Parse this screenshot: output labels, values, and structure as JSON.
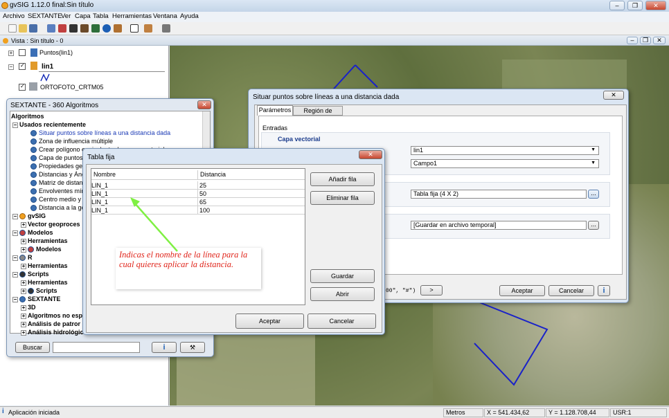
{
  "app": {
    "title": "gvSIG 1.12.0 final:Sin título",
    "minimize": "–",
    "restore": "❐",
    "close": "✕"
  },
  "menu": [
    "Archivo",
    "SEXTANTE",
    "Ver",
    "Capa",
    "Tabla",
    "Herramientas",
    "Ventana",
    "Ayuda"
  ],
  "view": {
    "title": "Vista : Sin título - 0"
  },
  "layers": [
    {
      "name": "Puntos(lin1)"
    },
    {
      "name": "lin1"
    },
    {
      "name": "ORTOFOTO_CRTM05"
    }
  ],
  "sextante": {
    "title": "SEXTANTE - 360 Algoritmos",
    "root": "Algoritmos",
    "recent": "Usados recientemente",
    "recent_items": [
      "Situar puntos sobre líneas a una distancia dada",
      "Zona de influencia múltiple",
      "Crear polígono equivalente de mapa vectorial",
      "Capa de puntos",
      "Propiedades geo",
      "Distancias y Áng",
      "Matriz de distanc",
      "Envolventes mín",
      "Centro medio y d",
      "Distancia a la ge"
    ],
    "gvsig": "gvSIG",
    "vector_geo": "Vector geoproces",
    "models": "Modelos",
    "herramientas": "Herramientas",
    "models_sub": "Modelos",
    "r": "R",
    "r_sub": "Herramientas",
    "scripts": "Scripts",
    "scripts_h": "Herramientas",
    "scripts_s": "Scripts",
    "sextante": "SEXTANTE",
    "s3d": "3D",
    "s_alg": "Algoritmos no esp",
    "s_pat": "Análisis de patror",
    "s_hid": "Análisis hidrológic",
    "search_button": "Buscar",
    "info_button": "i"
  },
  "dialog": {
    "title": "Situar puntos sobre líneas a una distancia dada",
    "tabs": [
      "Parámetros",
      "Región de análisis"
    ],
    "entradas": "Entradas",
    "capa_vectorial": "Capa vectorial",
    "layer_value": "lin1",
    "field_value": "Campo1",
    "table_value": "Tabla fija (4 X 2)",
    "output_value": "[Guardar en archivo temporal]",
    "browse": "...",
    "cmd_text": "00\", \"#\")",
    "next": ">",
    "accept": "Aceptar",
    "cancel": "Cancelar",
    "info": "i",
    "close": "✕"
  },
  "table_dialog": {
    "title": "Tabla fija",
    "close": "✕",
    "columns": [
      "Nombre",
      "Distancia"
    ],
    "rows": [
      [
        "LIN_1",
        "25"
      ],
      [
        "LIN_1",
        "50"
      ],
      [
        "LIN_1",
        "65"
      ],
      [
        "LIN_1",
        "100"
      ]
    ],
    "add_row": "Añadir fila",
    "remove_row": "Eliminar fila",
    "save": "Guardar",
    "open": "Abrir",
    "accept": "Aceptar",
    "cancel": "Cancelar"
  },
  "annotation": {
    "text": "Indicas el nombre de la línea para la cual quieres aplicar la distancia.",
    "color": "#e0251b",
    "arrow_color": "#7ff043"
  },
  "status": {
    "message": "Aplicación iniciada",
    "units": "Metros",
    "x": "X = 541.434,62",
    "y": "Y = 1.128.708,44",
    "srs": "USR:1"
  }
}
